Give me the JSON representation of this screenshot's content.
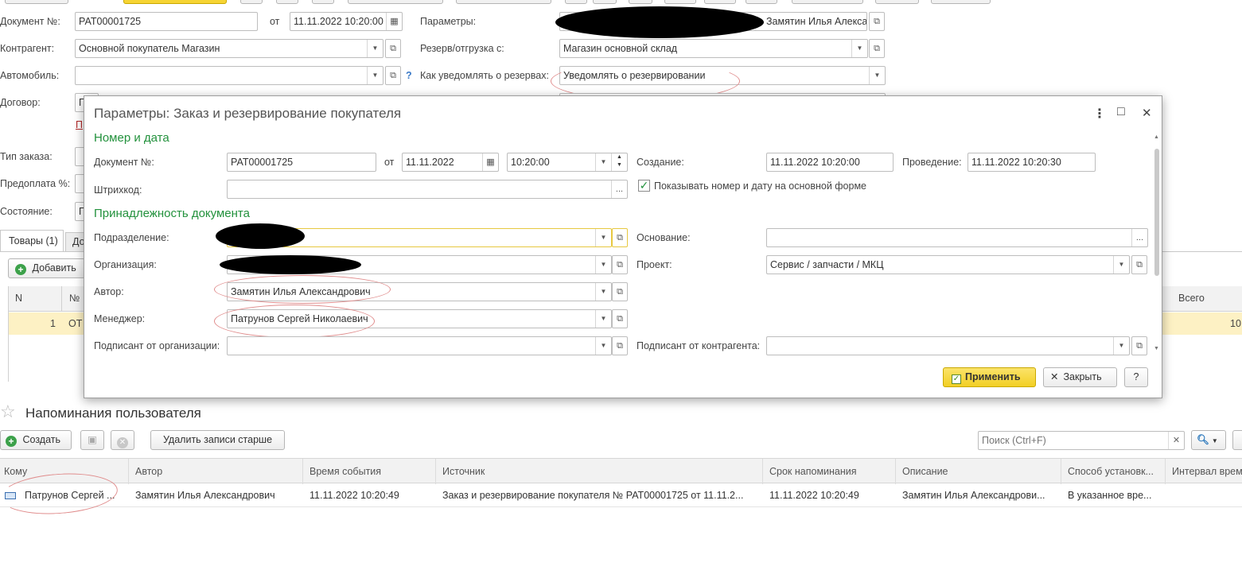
{
  "form": {
    "doc_label": "Документ №:",
    "doc_number": "РАТ00001725",
    "from_label": "от",
    "doc_datetime": "11.11.2022 10:20:00",
    "params_label": "Параметры:",
    "params_value": "Замятин Илья Алекса",
    "counterparty_label": "Контрагент:",
    "counterparty_value": "Основной покупатель Магазин",
    "reserve_label": "Резерв/отгрузка с:",
    "reserve_value": "Магазин основной склад",
    "car_label": "Автомобиль:",
    "car_value": "",
    "notify_label": "Как уведомлять о резервах:",
    "notify_value": "Уведомлять о резервировании",
    "help_q": "?",
    "contract_label": "Договор:",
    "contract_value": "П",
    "red_link": "П",
    "order_type_label": "Тип заказа:",
    "prepay_label": "Предоплата %:",
    "state_label": "Состояние:",
    "state_value": "П",
    "tab_goods": "Товары (1)",
    "tab_other": "До",
    "add_button": "Добавить",
    "col_n": "N",
    "col_no": "№",
    "col_total": "Всего",
    "row_n": "1",
    "row_no": "ОТ",
    "row_total": "10"
  },
  "dialog": {
    "title": "Параметры: Заказ и резервирование покупателя",
    "more_icon": "⋮",
    "max_icon": "□",
    "close_icon": "✕",
    "section_number": "Номер и дата",
    "doc_label": "Документ №:",
    "doc_number": "РАТ00001725",
    "from_label": "от",
    "date": "11.11.2022",
    "time": "10:20:00",
    "created_label": "Создание:",
    "created_value": "11.11.2022 10:20:00",
    "posted_label": "Проведение:",
    "posted_value": "11.11.2022 10:20:30",
    "barcode_label": "Штрихкод:",
    "barcode_value": "",
    "show_number_label": "Показывать номер и дату на основной форме",
    "show_number_checked": true,
    "section_ownership": "Принадлежность документа",
    "division_label": "Подразделение:",
    "division_value": "",
    "basis_label": "Основание:",
    "basis_value": "",
    "org_label": "Организация:",
    "org_value": "",
    "project_label": "Проект:",
    "project_value": "Сервис / запчасти / МКЦ",
    "author_label": "Автор:",
    "author_value": "Замятин Илья Александрович",
    "manager_label": "Менеджер:",
    "manager_value": "Патрунов Сергей Николаевич",
    "signer_org_label": "Подписант от организации:",
    "signer_org_value": "",
    "signer_cp_label": "Подписант от контрагента:",
    "signer_cp_value": "",
    "apply_button": "Применить",
    "close_button": "Закрыть",
    "help_button": "?"
  },
  "reminders": {
    "title": "Напоминания пользователя",
    "create_button": "Создать",
    "delete_older_button": "Удалить записи старше",
    "search_placeholder": "Поиск (Ctrl+F)",
    "columns": [
      "Кому",
      "Автор",
      "Время события",
      "Источник",
      "Срок напоминания",
      "Описание",
      "Способ установк...",
      "Интервал врем"
    ],
    "row": {
      "to": "Патрунов Сергей ...",
      "author": "Замятин Илья Александрович",
      "event_time": "11.11.2022 10:20:49",
      "source": "Заказ и резервирование покупателя № РАТ00001725 от 11.11.2...",
      "deadline": "11.11.2022 10:20:49",
      "description": "Замятин Илья Александрови...",
      "method": "В указанное вре...",
      "interval": ""
    }
  },
  "colors": {
    "accent_green": "#22913c",
    "apply_yellow": "#f6d434",
    "row_highlight": "#fdf1c4",
    "markup_red": "#e08c8c"
  }
}
